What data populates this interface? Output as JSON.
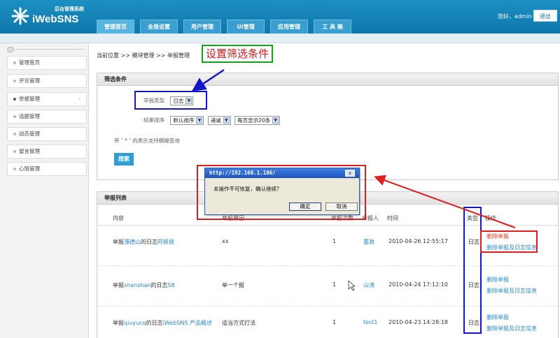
{
  "header": {
    "logo_sub": "后台管理系统",
    "logo_name": "iWebSNS",
    "greeting": "您好，admin",
    "logout_label": "退出"
  },
  "nav": {
    "tabs": [
      {
        "label": "管理首页"
      },
      {
        "label": "全局设置"
      },
      {
        "label": "用户管理"
      },
      {
        "label": "UI管理"
      },
      {
        "label": "应用管理"
      },
      {
        "label": "工 具 箱"
      }
    ],
    "active_index": 0
  },
  "sidebar": {
    "items": [
      {
        "label": "管理首页"
      },
      {
        "label": "评论管理"
      },
      {
        "label": "举报管理"
      },
      {
        "label": "话题管理"
      },
      {
        "label": "动态管理"
      },
      {
        "label": "留言管理"
      },
      {
        "label": "心情管理"
      }
    ],
    "active_index": 2
  },
  "breadcrumb": "当前位置 >> 模块管理 >> 举报管理",
  "annotation": {
    "title": "设置筛选条件"
  },
  "filter": {
    "title": "筛选条件",
    "type_label": "举报类型",
    "type_value": "日志",
    "sort_label": "结果排序",
    "sort_value": "默认排序",
    "order_value": "递减",
    "page_size_value": "每页显示20条",
    "hint": "带＇*＇的表示支持模糊查询",
    "search_label": "搜索"
  },
  "list": {
    "title": "举报列表",
    "columns": [
      "内容",
      "举报原因",
      "举报次数",
      "举报人",
      "时间",
      "类型",
      "操作"
    ],
    "rows": [
      {
        "content_prefix": "举报",
        "user": "薄德山",
        "content_mid": "的日志",
        "item": "阿佩佩",
        "reason": "xx",
        "count": "1",
        "reporter": "董政",
        "time": "2010-04-26 12:55:17",
        "type": "日志",
        "op1": "删除举报",
        "op2": "删除举报及日志信息"
      },
      {
        "content_prefix": "举报",
        "user": "shanshan",
        "content_mid": "的日志",
        "item": "58",
        "reason": "举一个报",
        "count": "1",
        "reporter": "山涛",
        "time": "2010-04-24 17:12:10",
        "type": "日志",
        "op1": "删除举报",
        "op2": "删除举报及日志信息"
      },
      {
        "content_prefix": "举报",
        "user": "qiuyucq",
        "content_mid": "的日志",
        "item": "iWebSNS 产品概述",
        "reason": "适当方式打法",
        "count": "1",
        "reporter": "test1",
        "time": "2010-04-23 14:28:18",
        "type": "日志",
        "op1": "删除举报",
        "op2": "删除举报及日志信息"
      }
    ]
  },
  "dialog": {
    "title": "http://192.168.1.106/",
    "message": "本操作不可恢复，确认继续？",
    "ok_label": "确定",
    "cancel_label": "取消",
    "close_glyph": "x"
  },
  "colors": {
    "header_blue": "#1d8fc2",
    "annot_red": "#e01c1c",
    "annot_blue": "#1414c8",
    "annot_green": "#18a018",
    "link_blue": "#2a8ac4"
  }
}
